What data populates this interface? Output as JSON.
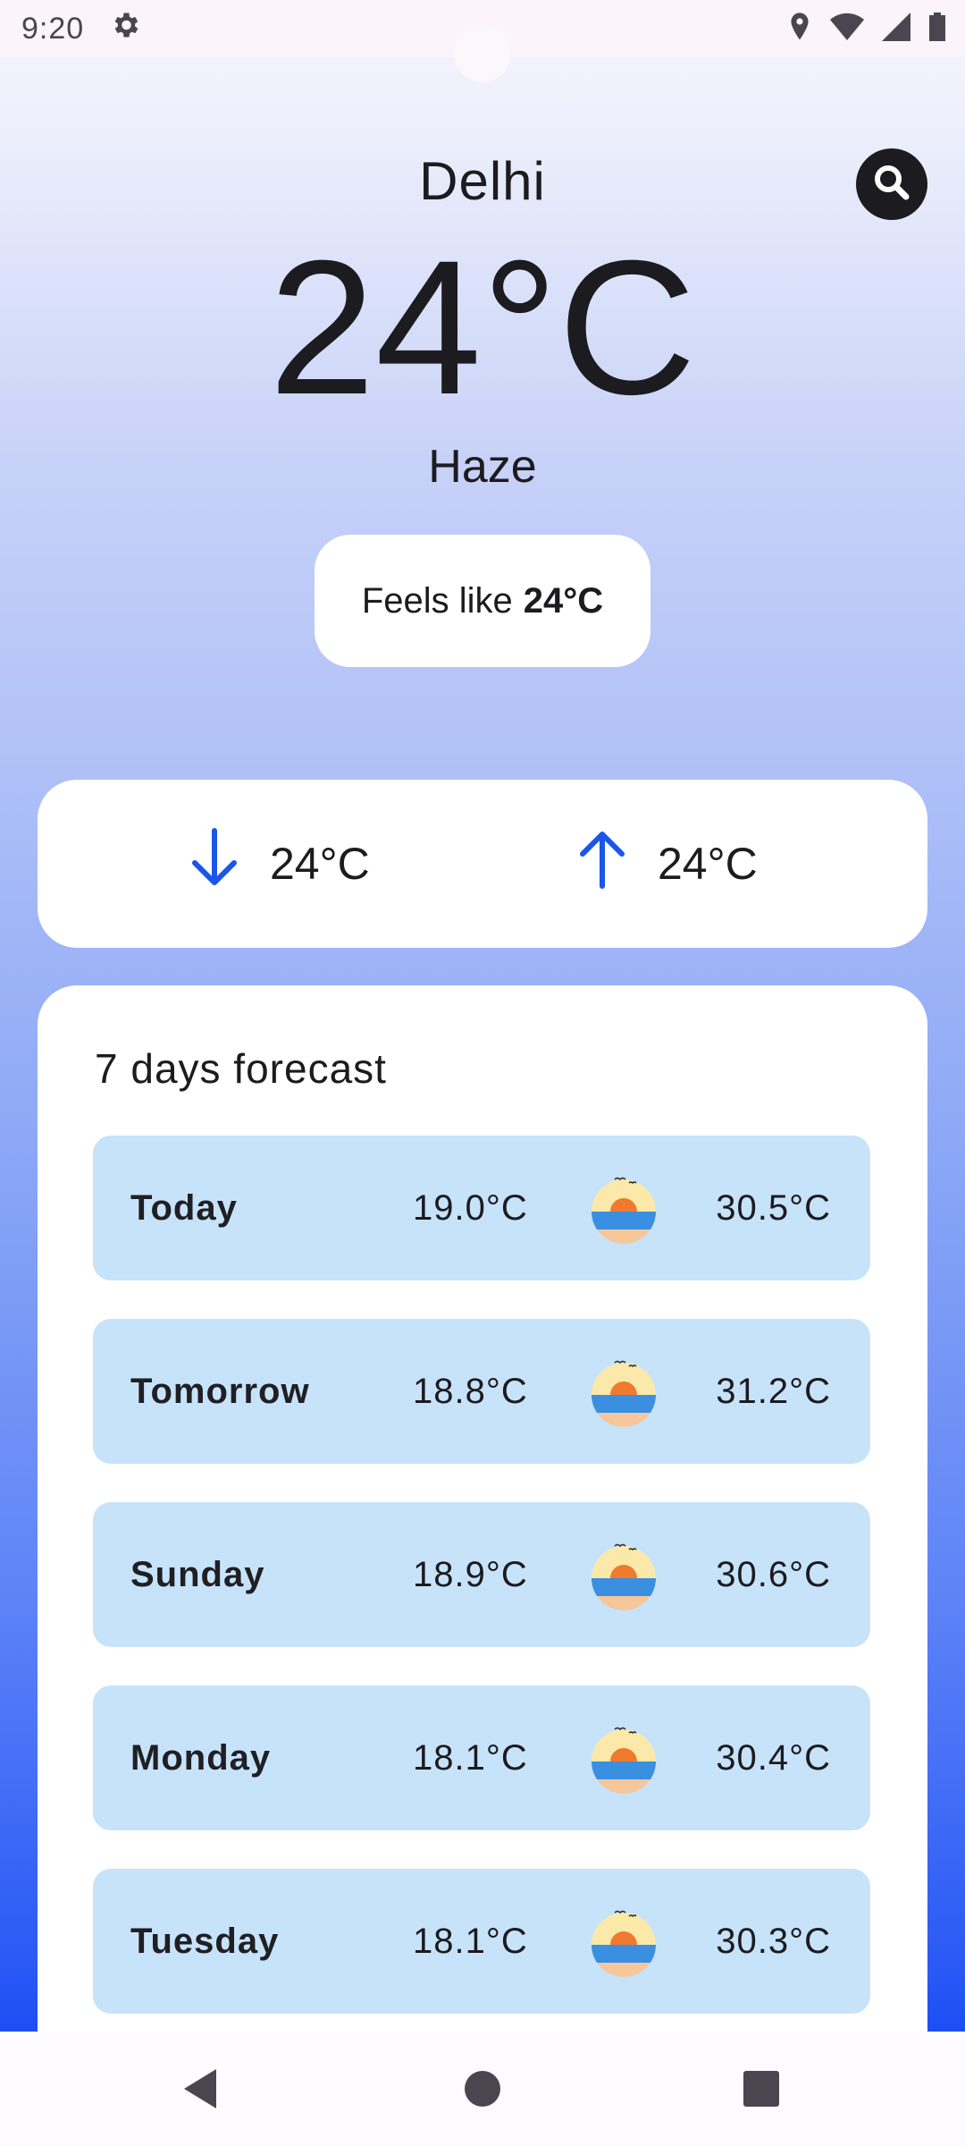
{
  "status_bar": {
    "time": "9:20",
    "icons": [
      "settings-icon",
      "location-icon",
      "wifi-icon",
      "signal-icon",
      "battery-icon"
    ]
  },
  "weather": {
    "city": "Delhi",
    "temperature": "24°C",
    "condition": "Haze",
    "feels_like_label": "Feels like",
    "feels_like_value": "24°C"
  },
  "min_max": {
    "min": "24°C",
    "max": "24°C"
  },
  "forecast": {
    "title": "7 days forecast",
    "days": [
      {
        "day": "Today",
        "low": "19.0°C",
        "high": "30.5°C",
        "icon": "sunset-beach-icon"
      },
      {
        "day": "Tomorrow",
        "low": "18.8°C",
        "high": "31.2°C",
        "icon": "sunset-beach-icon"
      },
      {
        "day": "Sunday",
        "low": "18.9°C",
        "high": "30.6°C",
        "icon": "sunset-beach-icon"
      },
      {
        "day": "Monday",
        "low": "18.1°C",
        "high": "30.4°C",
        "icon": "sunset-beach-icon"
      },
      {
        "day": "Tuesday",
        "low": "18.1°C",
        "high": "30.3°C",
        "icon": "sunset-beach-icon"
      }
    ]
  },
  "colors": {
    "accent_arrow": "#1a56e8",
    "row_background": "#c7e3fa",
    "gradient_bottom": "#1b4df3"
  },
  "nav_bar": {
    "buttons": [
      "back-icon",
      "home-icon",
      "recents-icon"
    ]
  }
}
